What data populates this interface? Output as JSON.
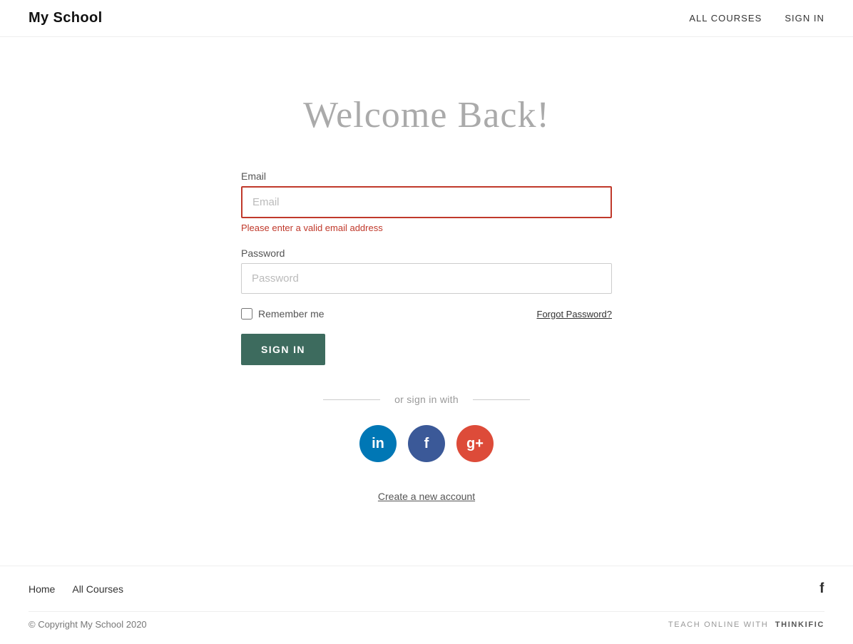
{
  "header": {
    "site_title": "My School",
    "nav": {
      "all_courses": "ALL COURSES",
      "sign_in": "SIGN IN"
    }
  },
  "main": {
    "welcome_title": "Welcome Back!",
    "form": {
      "email_label": "Email",
      "email_placeholder": "Email",
      "email_error": "Please enter a valid email address",
      "password_label": "Password",
      "password_placeholder": "Password",
      "remember_me_label": "Remember me",
      "forgot_password_label": "Forgot Password?",
      "sign_in_button": "SIGN IN"
    },
    "social": {
      "divider_text": "or sign in with"
    },
    "create_account_label": "Create a new account"
  },
  "footer": {
    "nav": {
      "home": "Home",
      "all_courses": "All Courses"
    },
    "copyright": "© Copyright My School 2020",
    "thinkific": {
      "prefix": "TEACH ONLINE WITH",
      "brand": "THINKIFIC"
    }
  },
  "colors": {
    "sign_in_btn_bg": "#3d6b5e",
    "linkedin_bg": "#0077b5",
    "facebook_bg": "#3b5998",
    "google_bg": "#dd4b39",
    "error_color": "#c0392b"
  }
}
